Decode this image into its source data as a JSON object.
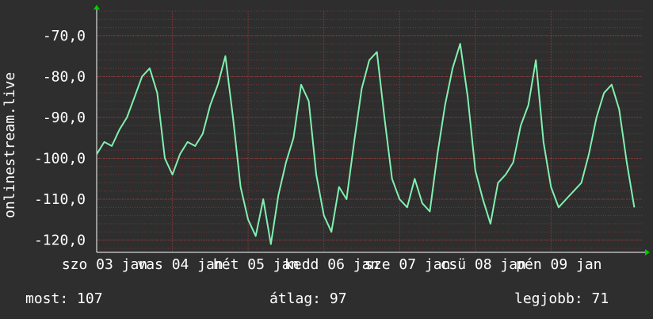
{
  "chart_data": {
    "type": "line",
    "ylabel": "onlinestream.live",
    "ylim": [
      -123,
      -64
    ],
    "xlim": [
      0,
      7.2
    ],
    "yticks": [
      {
        "value": -70,
        "label": "-70,0"
      },
      {
        "value": -80,
        "label": "-80,0"
      },
      {
        "value": -90,
        "label": "-90,0"
      },
      {
        "value": -100,
        "label": "-100,0"
      },
      {
        "value": -110,
        "label": "-110,0"
      },
      {
        "value": -120,
        "label": "-120,0"
      }
    ],
    "xticks": [
      {
        "value": 0,
        "label": "szo 03 jan"
      },
      {
        "value": 1,
        "label": "vas 04 jan"
      },
      {
        "value": 2,
        "label": "hét 05 jan"
      },
      {
        "value": 3,
        "label": "kedd 06 jan"
      },
      {
        "value": 4,
        "label": "sze 07 jan"
      },
      {
        "value": 5,
        "label": "csü 08 jan"
      },
      {
        "value": 6,
        "label": "pén 09 jan"
      }
    ],
    "colors": {
      "background": "#2e2e2e",
      "plot_bg": "#2e2e2e",
      "grid": "#8b3a3a",
      "line": "#80f0b0",
      "axis": "#ffffff",
      "arrow": "#00cc00"
    },
    "series": [
      {
        "name": "",
        "x": [
          0,
          0.1,
          0.2,
          0.3,
          0.4,
          0.5,
          0.6,
          0.7,
          0.8,
          0.9,
          1.0,
          1.1,
          1.2,
          1.3,
          1.4,
          1.5,
          1.6,
          1.7,
          1.8,
          1.9,
          2.0,
          2.1,
          2.2,
          2.3,
          2.4,
          2.5,
          2.6,
          2.7,
          2.8,
          2.9,
          3.0,
          3.1,
          3.2,
          3.3,
          3.4,
          3.5,
          3.6,
          3.7,
          3.8,
          3.9,
          4.0,
          4.1,
          4.2,
          4.3,
          4.4,
          4.5,
          4.6,
          4.7,
          4.8,
          4.9,
          5.0,
          5.1,
          5.2,
          5.3,
          5.4,
          5.5,
          5.6,
          5.7,
          5.8,
          5.9,
          6.0,
          6.1,
          6.2,
          6.3,
          6.4,
          6.5,
          6.6,
          6.7,
          6.8,
          6.9,
          7.0,
          7.1
        ],
        "values": [
          -99,
          -96,
          -97,
          -93,
          -90,
          -85,
          -80,
          -78,
          -84,
          -100,
          -104,
          -99,
          -96,
          -97,
          -94,
          -87,
          -82,
          -75,
          -90,
          -107,
          -115,
          -119,
          -110,
          -121,
          -109,
          -101,
          -95,
          -82,
          -86,
          -104,
          -114,
          -118,
          -107,
          -110,
          -96,
          -83,
          -76,
          -74,
          -90,
          -105,
          -110,
          -112,
          -105,
          -111,
          -113,
          -99,
          -87,
          -78,
          -72,
          -85,
          -103,
          -110,
          -116,
          -106,
          -104,
          -101,
          -92,
          -87,
          -76,
          -96,
          -107,
          -112,
          -110,
          -108,
          -106,
          -99,
          -90,
          -84,
          -82,
          -88,
          -101,
          -112
        ]
      }
    ]
  },
  "footer": {
    "current_label": "most: 107",
    "average_label": "átlag: 97",
    "best_label": "legjobb: 71"
  }
}
